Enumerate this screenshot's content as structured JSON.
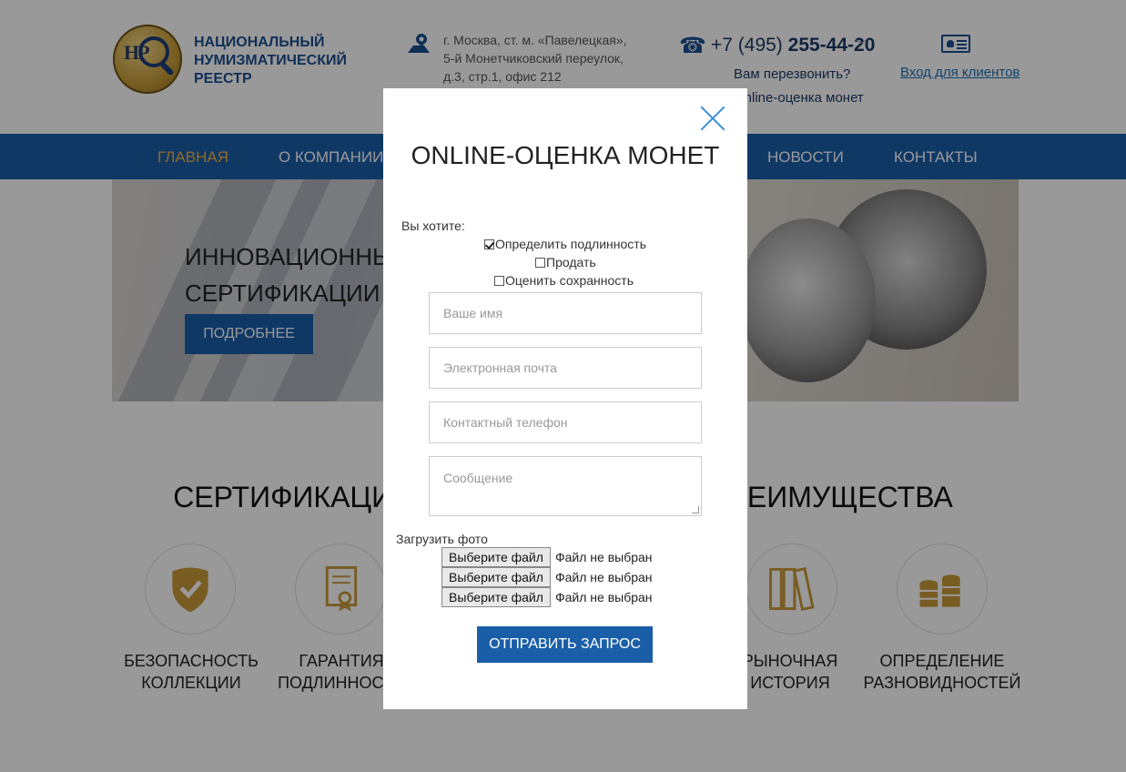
{
  "header": {
    "logo_monogram": "НР",
    "logo_lines": [
      "НАЦИОНАЛЬНЫЙ",
      "НУМИЗМАТИЧЕСКИЙ",
      "РЕЕСТР"
    ],
    "address_lines": [
      "г. Москва, ст. м. «Павелецкая»,",
      "5-й Монетчиковский переулок,",
      "д.3, стр.1, офис 212"
    ],
    "phone_prefix": "+7 (495) ",
    "phone_main": "255-44-20",
    "callback": "Вам перезвонить?",
    "online_link": "Online-оценка монет",
    "login": "Вход для клиентов"
  },
  "nav": {
    "items": [
      {
        "label": "ГЛАВНАЯ"
      },
      {
        "label": "О КОМПАНИИ"
      },
      {
        "label": "НОВОСТИ"
      },
      {
        "label": "КОНТАКТЫ"
      }
    ]
  },
  "hero": {
    "title_line1": "ИННОВАЦИОННЫЙ ПОДХОД К",
    "title_line2": "СЕРТИФИКАЦИИ МОНЕТ",
    "button": "ПОДРОБНЕЕ"
  },
  "section": {
    "title": "СЕРТИФИКАЦИЯ МОНЕТ: ВЫГОДЫ И ПРЕИМУЩЕСТВА",
    "features": [
      {
        "label1": "БЕЗОПАСНОСТЬ",
        "label2": "КОЛЛЕКЦИИ",
        "icon": "shield-check-icon"
      },
      {
        "label1": "ГАРАНТИЯ",
        "label2": "ПОДЛИННОСТИ",
        "icon": "certificate-icon"
      },
      {
        "label1": "РЫНОЧНАЯ",
        "label2": "ИСТОРИЯ",
        "icon": "binders-icon"
      },
      {
        "label1": "ОПРЕДЕЛЕНИЕ",
        "label2": "РАЗНОВИДНОСТЕЙ",
        "icon": "coins-stack-icon"
      }
    ]
  },
  "modal": {
    "title": "ONLINE-ОЦЕНКА МОНЕТ",
    "want_label": "Вы хотите:",
    "options": [
      {
        "label": "Определить подлинность",
        "checked": true
      },
      {
        "label": "Продать",
        "checked": false
      },
      {
        "label": "Оценить сохранность",
        "checked": false
      }
    ],
    "fields": {
      "name": "Ваше имя",
      "email": "Электронная почта",
      "phone": "Контактный телефон",
      "message": "Сообщение"
    },
    "upload_label": "Загрузить фото",
    "file_button": "Выберите файл",
    "file_status": "Файл не выбран",
    "submit": "ОТПРАВИТЬ ЗАПРОС"
  },
  "colors": {
    "nav_blue": "#1b5ea8",
    "active_nav": "#f2b441",
    "gold_icon": "#c99a3a",
    "close_x": "#3a8fd8"
  }
}
